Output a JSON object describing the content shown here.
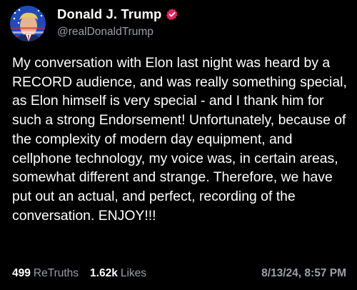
{
  "post": {
    "author": {
      "display_name": "Donald J. Trump",
      "handle": "@realDonaldTrump",
      "avatar_icon": "avatar-flag-portrait",
      "verified_icon": "verified-badge-icon",
      "verified_color": "#e0245e"
    },
    "text": "My conversation with Elon last night was heard by a RECORD audience, and was really something special, as Elon himself is very special - and I thank him for such a strong Endorsement! Unfortunately, because of the complexity of modern day equipment, and cellphone technology, my voice was, in certain areas, somewhat different and strange. Therefore, we have put out an actual, and perfect, recording of the conversation. ENJOY!!!",
    "stats": {
      "retruths_count": "499",
      "retruths_label": "ReTruths",
      "likes_count": "1.62k",
      "likes_label": "Likes"
    },
    "timestamp": "8/13/24, 8:57 PM"
  },
  "colors": {
    "background": "#000000",
    "text_primary": "#ffffff",
    "text_secondary": "#9aa0a6"
  }
}
